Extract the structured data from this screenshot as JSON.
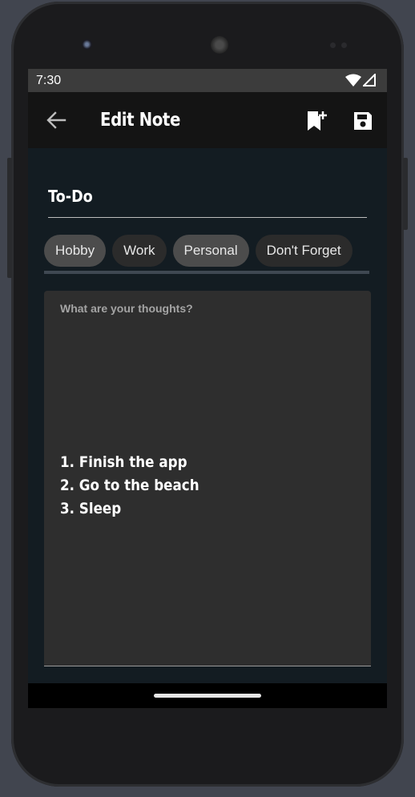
{
  "status_bar": {
    "time": "7:30",
    "icons": [
      "wifi-icon",
      "cell-signal-icon"
    ]
  },
  "app_bar": {
    "title": "Edit Note",
    "icons": [
      "back-arrow-icon",
      "bookmark-add-icon",
      "save-icon"
    ]
  },
  "note": {
    "title_value": "To-Do",
    "body_placeholder": "What are your thoughts?",
    "body_lines": [
      "1. Finish the app",
      "2. Go to the beach",
      "3. Sleep"
    ]
  },
  "tags": [
    {
      "label": "Hobby",
      "selected": true
    },
    {
      "label": "Work",
      "selected": false
    },
    {
      "label": "Personal",
      "selected": true
    },
    {
      "label": "Don't Forget",
      "selected": false
    }
  ],
  "colors": {
    "background": "#41454f",
    "screen": "#121c22",
    "app_bar": "#141414",
    "chip": "#2b2b2b",
    "chip_selected": "#4c4c4c",
    "note_body": "#2e2e2e"
  }
}
